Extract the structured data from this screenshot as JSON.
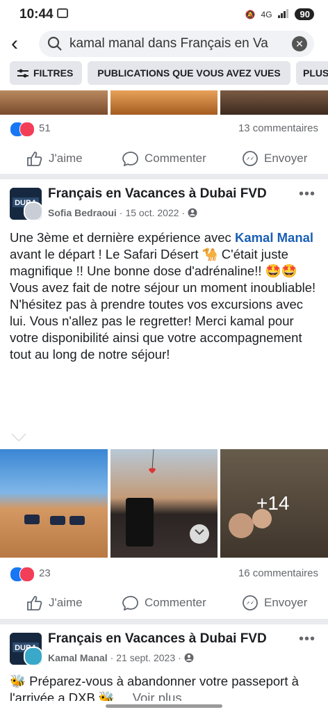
{
  "status": {
    "time": "10:44",
    "network": "4G",
    "battery": "90"
  },
  "search": {
    "query": "kamal manal dans Français en Va"
  },
  "filters": [
    {
      "label": "FILTRES"
    },
    {
      "label": "PUBLICATIONS QUE VOUS AVEZ VUES"
    },
    {
      "label": "PLUS"
    }
  ],
  "post_prev": {
    "reactions": "51",
    "comments": "13 commentaires"
  },
  "actions": {
    "like": "J'aime",
    "comment": "Commenter",
    "send": "Envoyer"
  },
  "post1": {
    "group": "Français en Vacances à Dubai FVD",
    "author": "Sofia Bedraoui",
    "date": "15 oct. 2022",
    "text_before": "Une 3ème et dernière expérience avec ",
    "mention": "Kamal Manal",
    "text_after": " avant le départ ! Le Safari Désert 🐪 C'était juste magnifique !! Une bonne dose d'adrénaline!! 🤩🤩 Vous avez fait de notre séjour un moment inoubliable! N'hésitez pas à prendre toutes vos excursions avec lui. Vous n'allez pas le regretter! Merci kamal pour votre disponibilité ainsi que votre accompagnement tout au long de notre séjour!",
    "more_photos": "+14",
    "reactions": "23",
    "comments": "16 commentaires"
  },
  "post2": {
    "group": "Français en Vacances à Dubai FVD",
    "author": "Kamal Manal",
    "date": "21 sept. 2023",
    "text": "🐝 Préparez-vous à abandonner votre passeport à l'arrivée a DXB 🐝 ...",
    "see_more": "Voir plus"
  }
}
